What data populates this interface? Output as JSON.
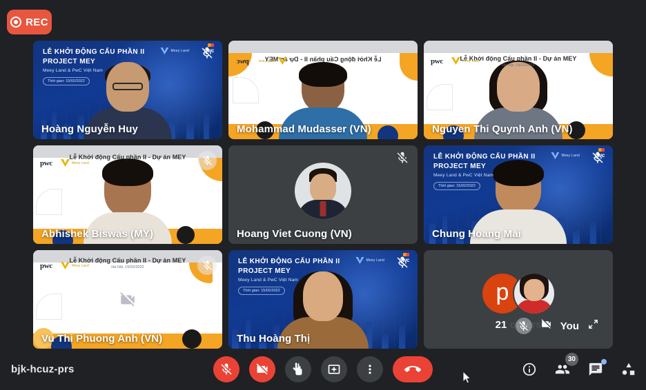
{
  "app": {
    "meeting_code": "bjk-hcuz-prs",
    "recording_label": "REC"
  },
  "deck": {
    "blue_title_line1": "LỄ KHỞI ĐỘNG CẤU PHẦN II",
    "blue_title_line2": "PROJECT MEY",
    "blue_subtitle": "Meey Land & PwC Việt Nam",
    "blue_chip": "Thời gian: 15/02/2022",
    "white_title": "Lễ Khởi động Cấu phần II - Dự án MEY",
    "white_subtitle": "Hà Nội, 15/02/2022",
    "logo_pwc": "pwc",
    "logo_meey": "Meey Land"
  },
  "participants": [
    {
      "name": "Hoàng Nguyễn Huy",
      "muted": true,
      "camera_on": true,
      "background": "blue",
      "mic_badge": false
    },
    {
      "name": "Mohammad Mudasser (VN)",
      "muted": false,
      "camera_on": true,
      "background": "white-mirrored",
      "mic_badge": false
    },
    {
      "name": "Nguyen Thi Quynh Anh (VN)",
      "muted": false,
      "camera_on": true,
      "background": "white",
      "mic_badge": false
    },
    {
      "name": "Abhishek Biswas (MY)",
      "muted": true,
      "camera_on": true,
      "background": "white",
      "mic_badge": true
    },
    {
      "name": "Hoang Viet Cuong (VN)",
      "muted": true,
      "camera_on": false,
      "background": "avatar",
      "mic_badge": false
    },
    {
      "name": "Chung Hoang Mai",
      "muted": true,
      "camera_on": true,
      "background": "blue",
      "mic_badge": false
    },
    {
      "name": "Vu Thi Phuong Anh (VN)",
      "muted": true,
      "camera_on": false,
      "background": "white",
      "mic_badge": true
    },
    {
      "name": "Thu Hoàng Thị",
      "muted": true,
      "camera_on": true,
      "background": "blue",
      "mic_badge": false
    }
  ],
  "others_tile": {
    "label": "21 others",
    "avatar_letter": "p"
  },
  "self_view": {
    "label": "You",
    "mic_state": "muted",
    "camera_state": "off",
    "expand_icon": "expand-icon"
  },
  "controls": {
    "mic": {
      "name": "microphone-off-button",
      "state": "off"
    },
    "camera": {
      "name": "camera-off-button",
      "state": "off"
    },
    "raise_hand": {
      "name": "raise-hand-button"
    },
    "present": {
      "name": "present-screen-button"
    },
    "more": {
      "name": "more-options-button"
    },
    "end_call": {
      "name": "end-call-button"
    }
  },
  "right_controls": {
    "info": "meeting-details-icon",
    "people_count": "30",
    "chat_unread": true,
    "activities": "activities-icon"
  },
  "colors": {
    "accent_red": "#ea4335",
    "rec_badge": "#e8563f",
    "tile_bg": "#3c4043",
    "page_bg": "#202124",
    "deck_blue": "#12357f",
    "deck_orange": "#f5a524",
    "badge_gray": "#5f6368",
    "chat_dot": "#8ab4f8"
  }
}
